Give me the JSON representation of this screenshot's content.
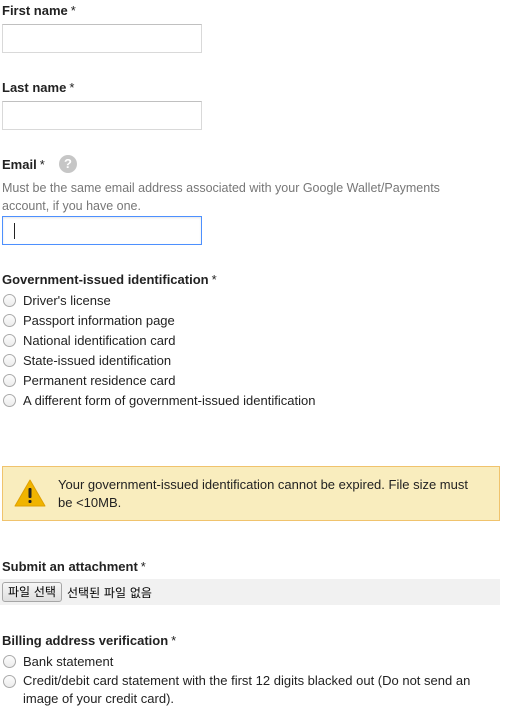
{
  "fields": {
    "first_name": {
      "label": "First name",
      "required_mark": "*",
      "value": ""
    },
    "last_name": {
      "label": "Last name",
      "required_mark": "*",
      "value": ""
    },
    "email": {
      "label": "Email",
      "required_mark": "*",
      "help_icon_text": "?",
      "hint": "Must be the same email address associated with your Google Wallet/Payments account, if you have one.",
      "value": ""
    }
  },
  "government_id": {
    "label": "Government-issued identification",
    "required_mark": "*",
    "options": [
      "Driver's license",
      "Passport information page",
      "National identification card",
      "State-issued identification",
      "Permanent residence card",
      "A different form of government-issued identification"
    ]
  },
  "notice": {
    "icon": "warning-icon",
    "text": "Your government-issued identification cannot be expired. File size must be <10MB.",
    "colors": {
      "background": "#f9edbe",
      "border": "#f0c36d"
    }
  },
  "attachment": {
    "label": "Submit an attachment",
    "required_mark": "*",
    "button_label": "파일 선택",
    "status": "선택된 파일 없음"
  },
  "billing": {
    "label": "Billing address verification",
    "required_mark": "*",
    "options": [
      "Bank statement",
      "Credit/debit card statement with the first 12 digits blacked out (Do not send an image of your credit card)."
    ]
  },
  "colors": {
    "focus_border": "#4d90fe",
    "hint_text": "#777777",
    "help_icon": "#c6c6c6"
  }
}
